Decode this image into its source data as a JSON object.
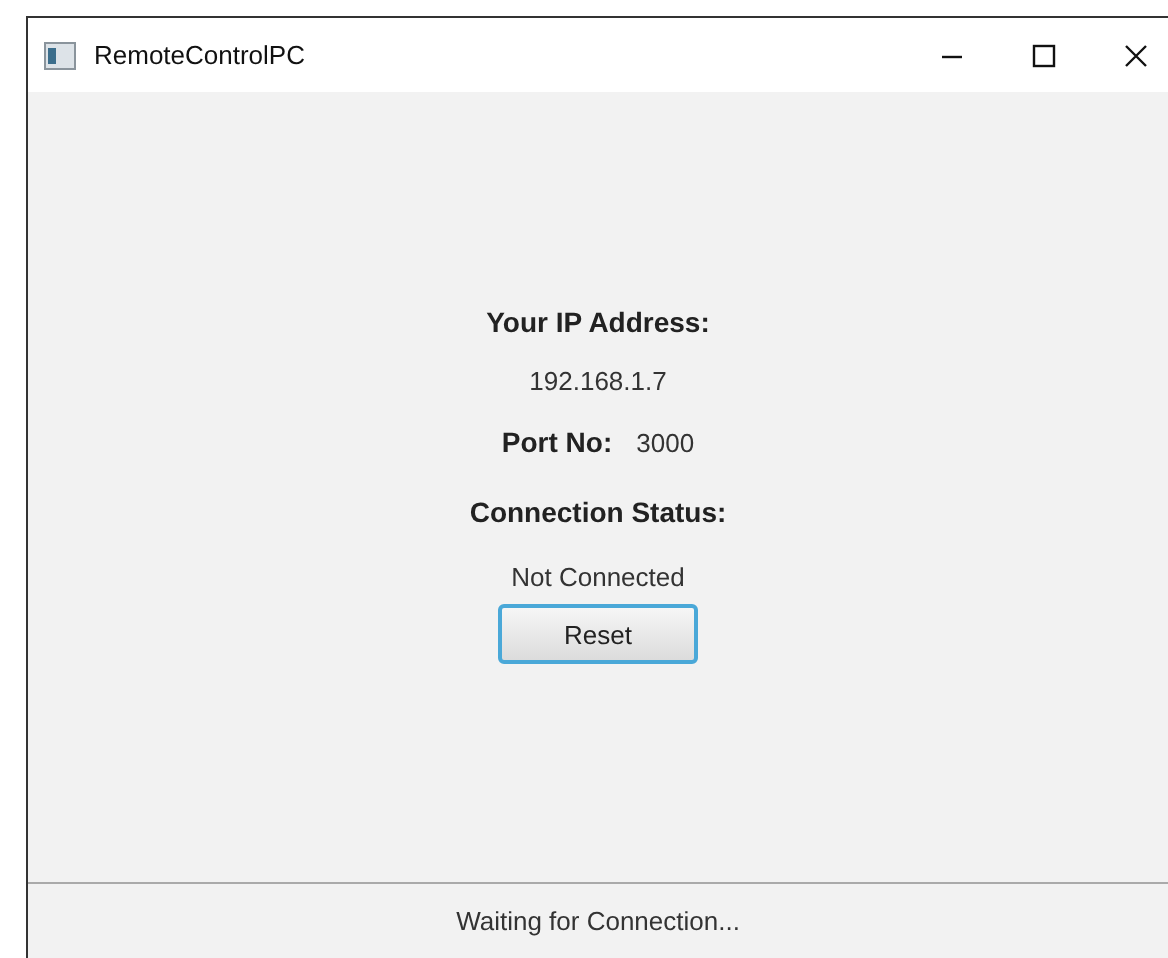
{
  "window": {
    "title": "RemoteControlPC"
  },
  "ip": {
    "label": "Your IP Address:",
    "value": "192.168.1.7"
  },
  "port": {
    "label": "Port No:",
    "value": "3000"
  },
  "connection": {
    "label": "Connection Status:",
    "value": "Not Connected"
  },
  "buttons": [
    {
      "label": "Reset",
      "focused": true
    }
  ],
  "status_bar": {
    "text": "Waiting for Connection..."
  }
}
